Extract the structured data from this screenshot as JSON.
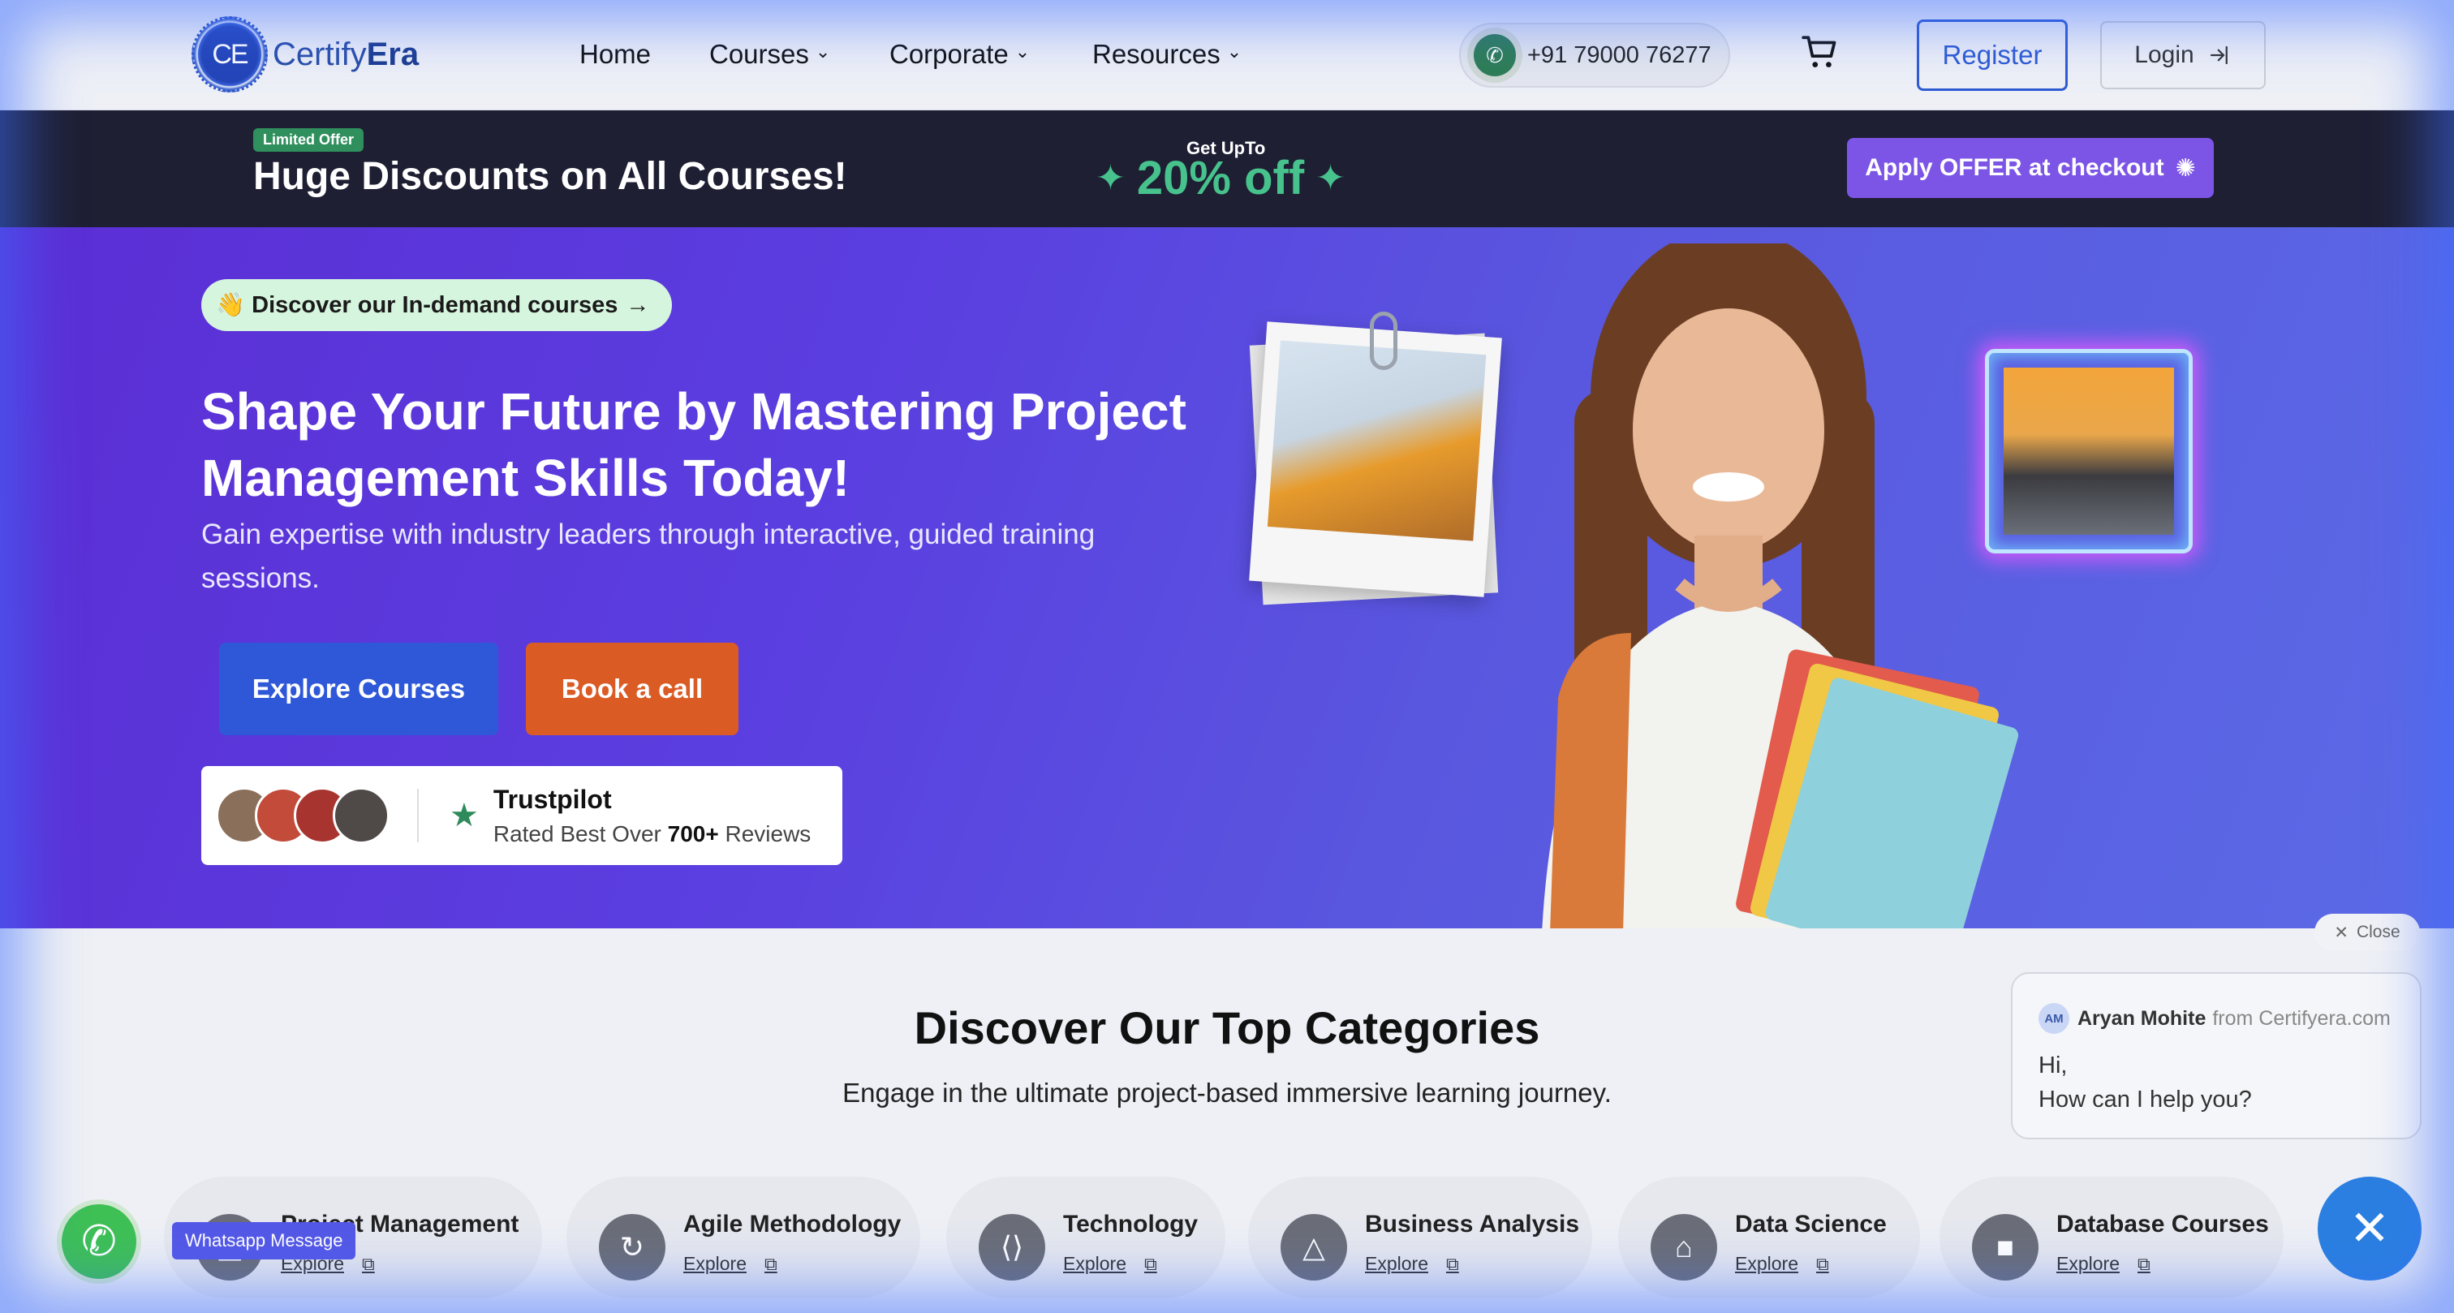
{
  "header": {
    "logo_initials": "CE",
    "logo_name_light": "Certify",
    "logo_name_bold": "Era",
    "nav": [
      {
        "label": "Home",
        "dropdown": false
      },
      {
        "label": "Courses",
        "dropdown": true
      },
      {
        "label": "Corporate",
        "dropdown": true
      },
      {
        "label": "Resources",
        "dropdown": true
      }
    ],
    "phone": "+91 79000 76277",
    "register_label": "Register",
    "login_label": "Login"
  },
  "offer": {
    "badge": "Limited Offer",
    "title": "Huge Discounts on All Courses!",
    "upto_label": "Get UpTo",
    "discount": "20% off",
    "cta": "Apply OFFER at checkout"
  },
  "hero": {
    "pill": "👋 Discover our In-demand courses",
    "title": "Shape Your Future by Mastering Project Management Skills Today!",
    "subtitle": "Gain expertise with industry leaders through interactive, guided training sessions.",
    "explore_label": "Explore Courses",
    "book_label": "Book a call",
    "trust_name": "Trustpilot",
    "trust_prefix": "Rated Best Over ",
    "trust_count": "700+",
    "trust_suffix": " Reviews"
  },
  "categories": {
    "title": "Discover Our Top Categories",
    "subtitle": "Engage in the ultimate project-based immersive learning journey.",
    "explore_label": "Explore",
    "items": [
      {
        "name": "Project Management"
      },
      {
        "name": "Agile Methodology"
      },
      {
        "name": "Technology"
      },
      {
        "name": "Business Analysis"
      },
      {
        "name": "Data Science"
      },
      {
        "name": "Database Courses"
      }
    ]
  },
  "chat": {
    "close_label": "Close",
    "avatar_initials": "AM",
    "agent_name": "Aryan Mohite",
    "agent_from": "from Certifyera.com",
    "line1": "Hi,",
    "line2": "How can I help you?"
  },
  "whatsapp": {
    "label": "Whatsapp Message"
  },
  "colors": {
    "brand_blue": "#2f58d9",
    "offer_green": "#47c28d",
    "book_orange": "#db5b25",
    "apply_purple": "#7c55e6",
    "hero_purple": "#5b2ed4"
  }
}
